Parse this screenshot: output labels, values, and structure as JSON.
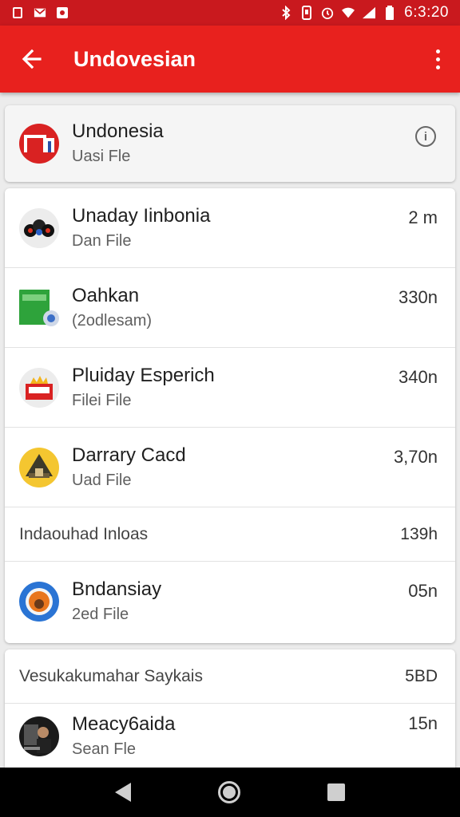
{
  "status_bar": {
    "time": "6:3:20",
    "icons": [
      "notification-icon",
      "gmail-icon",
      "app-icon",
      "bluetooth-icon",
      "vibrate-icon",
      "alarm-icon",
      "wifi-icon",
      "signal-icon",
      "battery-icon"
    ]
  },
  "app_bar": {
    "title": "Undovesian",
    "back_icon": "arrow-back-icon",
    "menu_icon": "more-vert-icon"
  },
  "top_item": {
    "title": "Undonesia",
    "subtitle": "Uasi Fle",
    "icon": "info-icon"
  },
  "list": [
    {
      "title": "Unaday Iinbonia",
      "subtitle": "Dan File",
      "meta": "2 m",
      "avatar": "controller-avatar"
    },
    {
      "title": "Oahkan",
      "subtitle": "(2odlesam)",
      "meta": "330n",
      "avatar": "green-app-avatar"
    },
    {
      "title": "Pluiday Esperich",
      "subtitle": "Filei File",
      "meta": "340n",
      "avatar": "tray-avatar"
    },
    {
      "title": "Darrary Cacd",
      "subtitle": "Uad File",
      "meta": "3,70n",
      "avatar": "tent-avatar"
    }
  ],
  "section_header_1": {
    "label": "Indaouhad Inloas",
    "meta": "139h"
  },
  "list_b": [
    {
      "title": "Bndansiay",
      "subtitle": "2ed File",
      "meta": "05n",
      "avatar": "orange-ring-avatar"
    }
  ],
  "section_header_2": {
    "label": "Vesukakumahar Saykais",
    "meta": "5BD"
  },
  "list_c": [
    {
      "title": "Meacy6aida",
      "subtitle": "Sean Fle",
      "meta": "15n",
      "avatar": "photo-avatar"
    }
  ],
  "colors": {
    "status_bar": "#c9191e",
    "app_bar": "#e8211e",
    "nav_bar": "#000000"
  },
  "nav": {
    "back_icon": "nav-back-icon",
    "home_icon": "nav-home-icon",
    "recents_icon": "nav-recents-icon"
  }
}
